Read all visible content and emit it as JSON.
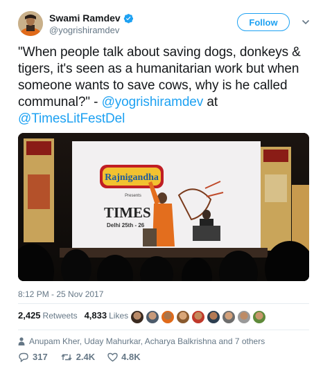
{
  "author": {
    "name": "Swami Ramdev",
    "handle": "@yogrishiramdev",
    "verified": true
  },
  "follow_button": {
    "label": "Follow"
  },
  "tweet": {
    "text": "\"When people talk about saving dogs, donkeys & tigers, it's seen as a humanitarian work but when someone wants to save cows, why is he called communal?\" -",
    "mention_1": "@yogrishiramdev",
    "connector": " at ",
    "mention_2": "@TimesLitFestDel"
  },
  "media": {
    "banner_brand": "Rajnigandha",
    "banner_presents": "Presents",
    "banner_title": "TIMES",
    "banner_dates": "Delhi 25th - 26"
  },
  "timestamp": "8:12 PM - 25 Nov 2017",
  "stats": {
    "retweets_count": "2,425",
    "retweets_label": "Retweets",
    "likes_count": "4,833",
    "likes_label": "Likes"
  },
  "liked_by_text": "Anupam Kher, Uday Mahurkar, Acharya Balkrishna and 7 others",
  "actions": {
    "replies": "317",
    "retweets": "2.4K",
    "likes": "4.8K"
  },
  "colors": {
    "accent": "#1da1f2",
    "secondary_text": "#657786",
    "primary_text": "#14171a"
  },
  "icons": [
    "verified-badge-icon",
    "chevron-down-icon",
    "person-icon",
    "reply-icon",
    "retweet-icon",
    "heart-icon"
  ]
}
